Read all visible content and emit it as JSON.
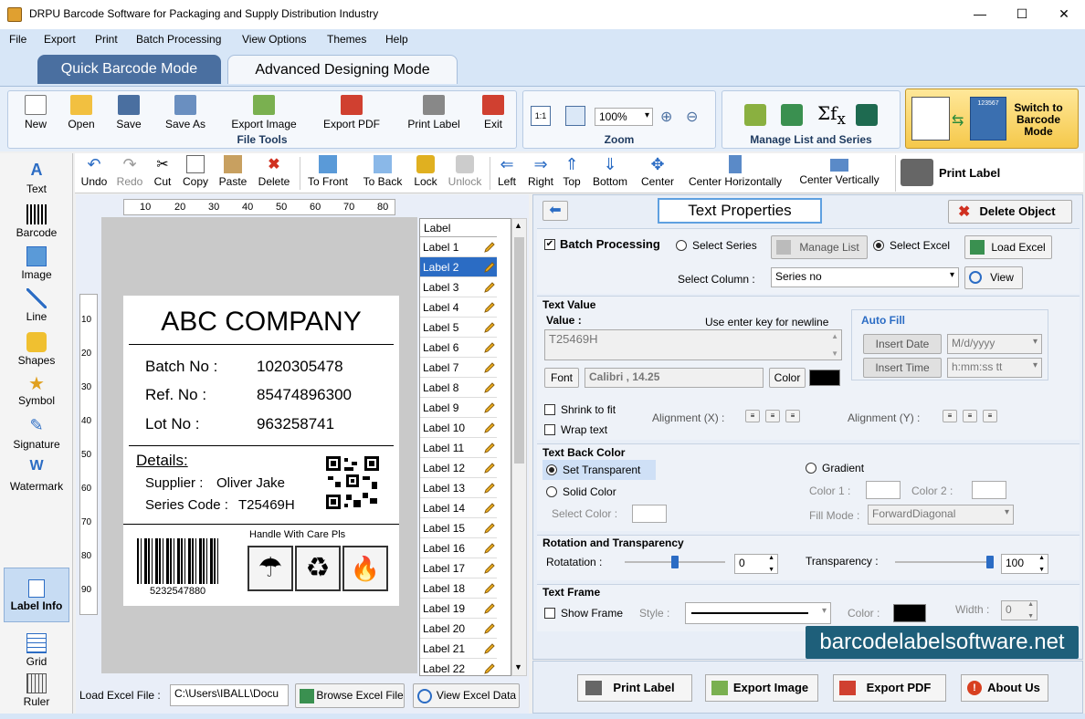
{
  "window": {
    "title": "DRPU Barcode Software for Packaging and Supply Distribution Industry"
  },
  "menu": [
    "File",
    "Export",
    "Print",
    "Batch Processing",
    "View Options",
    "Themes",
    "Help"
  ],
  "modes": {
    "quick": "Quick Barcode Mode",
    "advanced": "Advanced Designing Mode"
  },
  "file_tools": {
    "group": "File Tools",
    "items": [
      "New",
      "Open",
      "Save",
      "Save As",
      "Export Image",
      "Export PDF",
      "Print Label",
      "Exit"
    ]
  },
  "zoom": {
    "group": "Zoom",
    "value": "100%"
  },
  "manage": {
    "group": "Manage List and Series"
  },
  "switch_mode": {
    "line1": "Switch to",
    "line2": "Barcode",
    "line3": "Mode",
    "sample": "123567"
  },
  "left_tools": [
    "Text",
    "Barcode",
    "Image",
    "Line",
    "Shapes",
    "Symbol",
    "Signature",
    "Watermark",
    "Label Info",
    "Grid",
    "Ruler"
  ],
  "edit_toolbar": {
    "items": [
      "Undo",
      "Redo",
      "Cut",
      "Copy",
      "Paste",
      "Delete",
      "To Front",
      "To Back",
      "Lock",
      "Unlock",
      "Left",
      "Right",
      "Top",
      "Bottom",
      "Center",
      "Center Horizontally",
      "Center Vertically"
    ],
    "print_label": "Print Label"
  },
  "ruler": {
    "top": [
      "10",
      "20",
      "30",
      "40",
      "50",
      "60",
      "70",
      "80"
    ],
    "left": [
      "10",
      "20",
      "30",
      "40",
      "50",
      "60",
      "70",
      "80",
      "90"
    ]
  },
  "label": {
    "company": "ABC COMPANY",
    "rows": [
      {
        "k": "Batch No :",
        "v": "1020305478"
      },
      {
        "k": "Ref. No :",
        "v": "85474896300"
      },
      {
        "k": "Lot No :",
        "v": "963258741"
      }
    ],
    "details_title": "Details:",
    "supplier_label": "Supplier :",
    "supplier": "Oliver Jake",
    "series_label": "Series Code :",
    "series": "T25469H",
    "barcode_number": "5232547880",
    "handle_text": "Handle With Care Pls"
  },
  "label_list": {
    "header": "Label",
    "items": [
      "Label 1",
      "Label 2",
      "Label 3",
      "Label 4",
      "Label 5",
      "Label 6",
      "Label 7",
      "Label 8",
      "Label 9",
      "Label 10",
      "Label 11",
      "Label 12",
      "Label 13",
      "Label 14",
      "Label 15",
      "Label 16",
      "Label 17",
      "Label 18",
      "Label 19",
      "Label 20",
      "Label 21",
      "Label 22"
    ],
    "selected_index": 1
  },
  "load_excel": {
    "label": "Load Excel File :",
    "path": "C:\\Users\\IBALL\\Docu",
    "browse": "Browse Excel File",
    "view": "View Excel Data"
  },
  "props": {
    "title": "Text Properties",
    "delete_object": "Delete Object",
    "batch_processing": "Batch Processing",
    "select_series": "Select Series",
    "manage_list": "Manage List",
    "select_excel": "Select Excel",
    "load_excel": "Load Excel",
    "select_column_label": "Select Column :",
    "select_column_value": "Series no",
    "view": "View",
    "text_value_title": "Text Value",
    "value_label": "Value :",
    "newline_hint": "Use enter key for newline",
    "value": "T25469H",
    "font_button": "Font",
    "font_value": "Calibri , 14.25",
    "color_button": "Color",
    "auto_fill": "Auto Fill",
    "insert_date": "Insert Date",
    "date_format": "M/d/yyyy",
    "insert_time": "Insert Time",
    "time_format": "h:mm:ss tt",
    "shrink_to_fit": "Shrink to fit",
    "wrap_text": "Wrap text",
    "alignment_x": "Alignment (X) :",
    "alignment_y": "Alignment (Y) :",
    "text_back_color": "Text Back Color",
    "set_transparent": "Set Transparent",
    "solid_color": "Solid Color",
    "select_color": "Select Color :",
    "gradient": "Gradient",
    "color1": "Color 1 :",
    "color2": "Color 2 :",
    "fill_mode_label": "Fill Mode :",
    "fill_mode": "ForwardDiagonal",
    "rotation_title": "Rotation and Transparency",
    "rotation_label": "Rotatation :",
    "rotation_value": "0",
    "rotation_fraction": 0.0,
    "transparency_label": "Transparency :",
    "transparency_value": "100",
    "transparency_fraction": 1.0,
    "text_frame": "Text Frame",
    "show_frame": "Show Frame",
    "style_label": "Style :",
    "frame_color_label": "Color :",
    "width_label": "Width :",
    "width_value": "0"
  },
  "bottom_buttons": [
    "Print Label",
    "Export Image",
    "Export PDF",
    "About Us"
  ],
  "watermark": "barcodelabelsoftware.net",
  "colors": {
    "accent": "#2b6cc4",
    "ribbon": "#d7e6f7",
    "tab_inactive": "#4a6fa0",
    "watermark_bg": "#1e5f7a"
  }
}
